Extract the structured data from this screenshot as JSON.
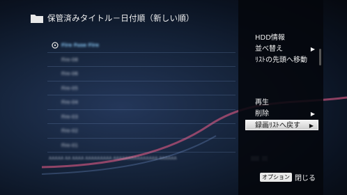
{
  "header": {
    "title": "保管済みタイトル－日付順（新しい順）",
    "icon": "folder-icon"
  },
  "list": {
    "rows": [
      "Fire Fuse Fire",
      "Fire-08",
      "Fire-06",
      "Fire-05",
      "Fire-04",
      "Fire-03",
      "Fire-02",
      "Fire-01"
    ],
    "footer": "AAAAA AA AAAA AAAAAAAAA AAAAAAAAAAAAAAA AAAAAA"
  },
  "menu": {
    "items": [
      {
        "label": "HDD情報",
        "has_submenu": false
      },
      {
        "label": "並べ替え",
        "has_submenu": true
      },
      {
        "label": "ﾘｽﾄの先頭へ移動",
        "has_submenu": false
      },
      {
        "label": "再生",
        "has_submenu": false
      },
      {
        "label": "削除",
        "has_submenu": true
      },
      {
        "label": "録画ﾘｽﾄへ戻す",
        "has_submenu": true,
        "selected": true
      }
    ],
    "arrow_glyph": "▶"
  },
  "footer": {
    "option_key": "オプション",
    "option_label": "閉じる"
  },
  "colors": {
    "menu_highlight": "#e6e6e6",
    "accent_curve": "#c4527a"
  }
}
